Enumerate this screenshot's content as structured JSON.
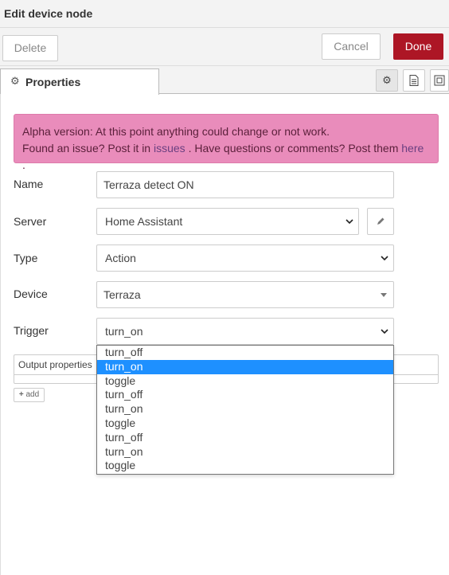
{
  "header": {
    "title": "Edit device node"
  },
  "toolbar": {
    "delete_label": "Delete",
    "cancel_label": "Cancel",
    "done_label": "Done"
  },
  "tabs": [
    {
      "label": "Properties",
      "icon": "gear-icon"
    }
  ],
  "tab_icons": [
    "gear-icon",
    "document-icon",
    "frame-icon"
  ],
  "alert": {
    "line1": "Alpha version: At this point anything could change or not work.",
    "line2_a": "Found an issue? Post it in ",
    "link_issues": "issues",
    "line2_b": " . Have questions or comments? Post them ",
    "link_here": "here",
    "line2_c": " ."
  },
  "form": {
    "name": {
      "label": "Name",
      "value": "Terraza detect ON"
    },
    "server": {
      "label": "Server",
      "value": "Home Assistant"
    },
    "type": {
      "label": "Type",
      "value": "Action"
    },
    "device": {
      "label": "Device",
      "value": "Terraza"
    },
    "trigger": {
      "label": "Trigger",
      "value": "turn_on"
    }
  },
  "output_properties": {
    "label": "Output properties",
    "add_label": "add"
  },
  "trigger_options": [
    "turn_off",
    "turn_on",
    "toggle",
    "turn_off",
    "turn_on",
    "toggle",
    "turn_off",
    "turn_on",
    "toggle"
  ],
  "trigger_selected_index": 1,
  "colors": {
    "done": "#ad1625",
    "alert_bg": "#e98cbb",
    "selected_option": "#1e90ff"
  }
}
